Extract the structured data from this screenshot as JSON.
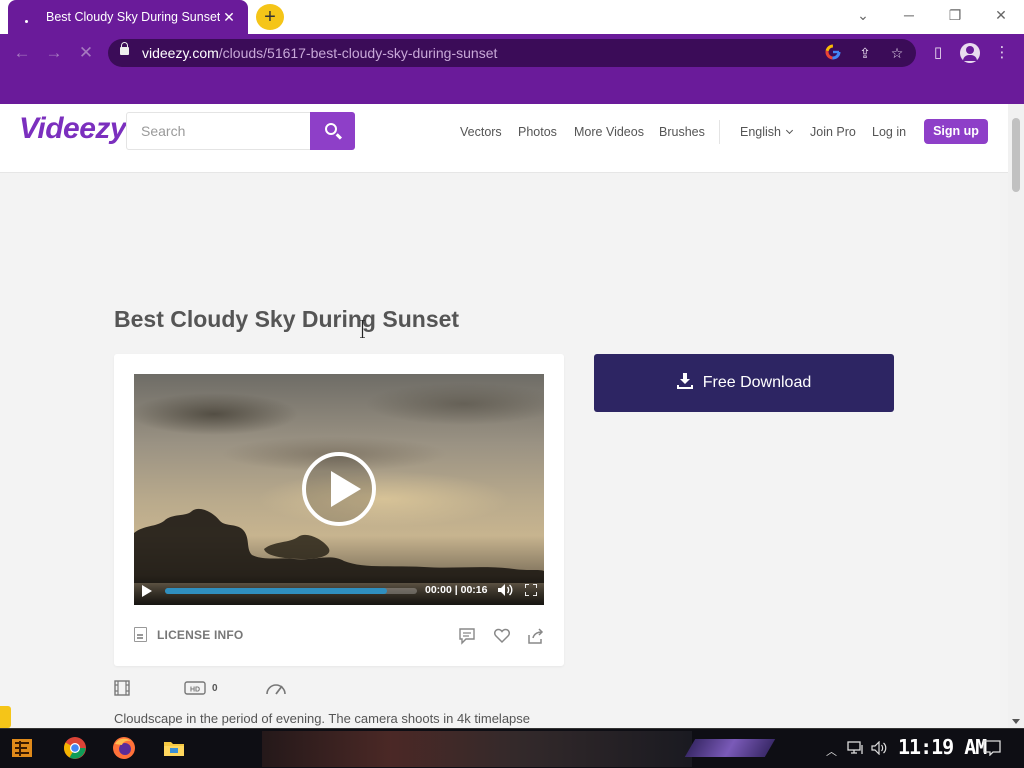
{
  "browser": {
    "tab_title": "Best Cloudy Sky During Sunset",
    "tab_close": "✕",
    "new_tab": "+",
    "url_domain": "videezy.com",
    "url_path": "/clouds/51617-best-cloudy-sky-during-sunset"
  },
  "site": {
    "logo": "Videezy",
    "search_placeholder": "Search",
    "nav": [
      "Vectors",
      "Photos",
      "More Videos",
      "Brushes"
    ],
    "language": "English",
    "join_pro": "Join Pro",
    "login": "Log in",
    "signup": "Sign up",
    "accent_color": "#8e3fc8"
  },
  "video_page": {
    "title": "Best Cloudy Sky During Sunset",
    "download_label": "Free Download",
    "player": {
      "time": "00:00 | 00:16",
      "progress": 0.88
    },
    "license_label": "LICENSE INFO",
    "hd_count": "0",
    "description": "Cloudscape in the period of evening. The camera shoots in 4k timelapse"
  },
  "taskbar": {
    "clock": "11:19 AM"
  }
}
